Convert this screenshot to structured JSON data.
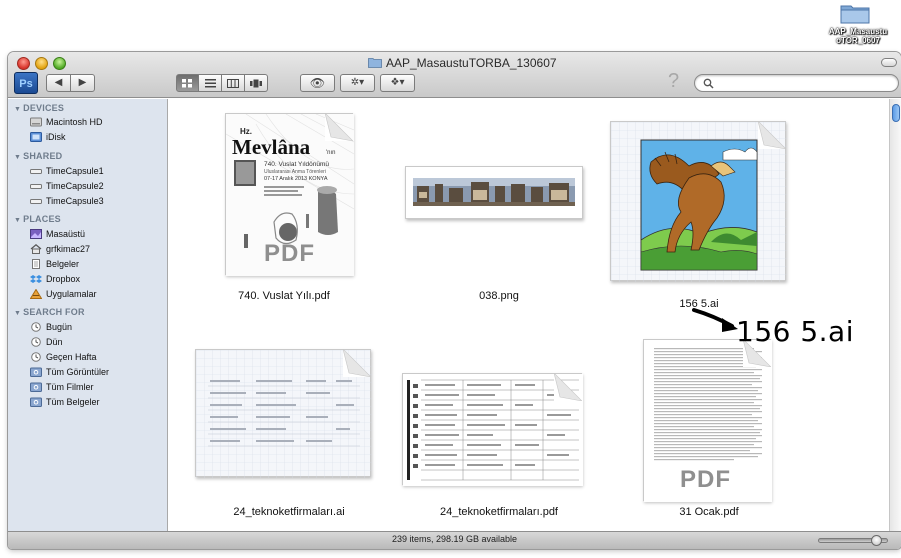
{
  "desktop": {
    "folder_label_line1": "AAP_Masaustu",
    "folder_label_line2": "oTOR_0607"
  },
  "window": {
    "title": "AAP_MasaustuTORBA_130607",
    "toolbar": {
      "app_icon_label": "Ps",
      "back_glyph": "◀",
      "forward_glyph": "▶",
      "view_modes": [
        "icon-view",
        "list-view",
        "column-view",
        "coverflow-view"
      ],
      "active_view": "icon-view",
      "quicklook_glyph": "👁",
      "action_glyph": "✲▾",
      "dropbox_glyph": "❖▾",
      "help_glyph": "?",
      "search_placeholder": "",
      "search_value": ""
    }
  },
  "sidebar": {
    "sections": [
      {
        "header": "DEVICES",
        "items": [
          {
            "label": "Macintosh HD",
            "icon": "hard-drive-icon"
          },
          {
            "label": "iDisk",
            "icon": "idisk-icon"
          }
        ]
      },
      {
        "header": "SHARED",
        "items": [
          {
            "label": "TimeCapsule1",
            "icon": "time-capsule-icon"
          },
          {
            "label": "TimeCapsule2",
            "icon": "time-capsule-icon"
          },
          {
            "label": "TimeCapsule3",
            "icon": "time-capsule-icon"
          }
        ]
      },
      {
        "header": "PLACES",
        "items": [
          {
            "label": "Masaüstü",
            "icon": "desktop-icon"
          },
          {
            "label": "grfkimac27",
            "icon": "home-icon"
          },
          {
            "label": "Belgeler",
            "icon": "documents-icon"
          },
          {
            "label": "Dropbox",
            "icon": "dropbox-icon"
          },
          {
            "label": "Uygulamalar",
            "icon": "applications-icon"
          }
        ]
      },
      {
        "header": "SEARCH FOR",
        "items": [
          {
            "label": "Bugün",
            "icon": "clock-icon"
          },
          {
            "label": "Dün",
            "icon": "clock-icon"
          },
          {
            "label": "Geçen Hafta",
            "icon": "clock-icon"
          },
          {
            "label": "Tüm Görüntüler",
            "icon": "smart-folder-icon"
          },
          {
            "label": "Tüm Filmler",
            "icon": "smart-folder-icon"
          },
          {
            "label": "Tüm Belgeler",
            "icon": "smart-folder-icon"
          }
        ]
      }
    ]
  },
  "files": [
    {
      "name": "740. Vuslat Yılı.pdf",
      "kind": "pdf-poster",
      "poster_title": "Mevlâna",
      "poster_prefix": "Hz.",
      "poster_suffix": "'nın",
      "poster_line1": "740. Vuslat Yıldönümü",
      "poster_line2": "Uluslararası Anma Törenleri",
      "poster_line3": "07-17 Aralık 2013 KONYA",
      "badge": "PDF"
    },
    {
      "name": "038.png",
      "kind": "png-banner"
    },
    {
      "name": "156 5.ai",
      "kind": "ai-griffin"
    },
    {
      "name": "24_teknoketfirmaları.ai",
      "kind": "ai-table"
    },
    {
      "name": "24_teknoketfirmaları.pdf",
      "kind": "pdf-table"
    },
    {
      "name": "31 Ocak.pdf",
      "kind": "pdf-text",
      "badge": "PDF"
    }
  ],
  "annotation": {
    "text": "156 5.ai"
  },
  "status": {
    "text": "239 items, 298.19 GB available"
  },
  "colors": {
    "sidebar_bg": "#dde4ee",
    "sidebar_header": "#6f7c8c",
    "accent_blue": "#3b74c4"
  }
}
